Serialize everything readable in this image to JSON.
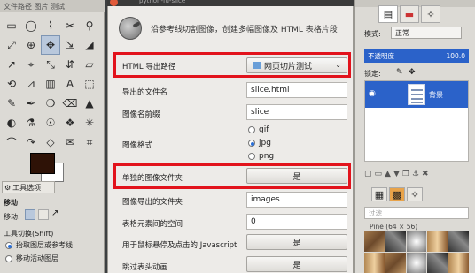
{
  "toolbox": {
    "title": "文件路径 图片 测试",
    "tools": [
      "▭",
      "◯",
      "⌇",
      "✂",
      "⚲",
      "⤢",
      "⊕",
      "✥",
      "⇲",
      "◢",
      "↗",
      "⌖",
      "⤡",
      "⇵",
      "▱",
      "⟲",
      "⊿",
      "▥",
      "A",
      "⬚",
      "✎",
      "✒",
      "❍",
      "⌫",
      "▲",
      "◐",
      "⚗",
      "☉",
      "❖",
      "✳",
      "⌒",
      "↷",
      "◇",
      "✉",
      "⌗"
    ],
    "options_tab": "工具选项",
    "section_move": "移动",
    "move_label": "移动:",
    "toggle_label": "工具切换(Shift)",
    "opt1": "抬取图层或参考线",
    "opt2": "移动活动图层"
  },
  "dialog": {
    "title": "python-fu-slice",
    "header": "沿参考线切割图像，创建多幅图像及 HTML 表格片段",
    "rows": [
      {
        "label": "HTML 导出路径",
        "value": "网页切片测试"
      },
      {
        "label": "导出的文件名",
        "value": "slice.html"
      },
      {
        "label": "图像名前缀",
        "value": "slice"
      },
      {
        "label": "图像格式",
        "opt_gif": "gif",
        "opt_jpg": "jpg",
        "opt_png": "png"
      },
      {
        "label": "单独的图像文件夹",
        "value": "是"
      },
      {
        "label": "图像导出的文件夹",
        "value": "images"
      },
      {
        "label": "表格元素间的空间",
        "value": "0"
      },
      {
        "label": "用于鼠标悬停及点击的 Javascript",
        "value": "是"
      },
      {
        "label": "跳过表头动画",
        "value": "是"
      }
    ]
  },
  "dock": {
    "mode_label": "模式:",
    "mode_value": "正常",
    "opacity_label": "不透明度",
    "opacity_value": "100.0",
    "lock_label": "锁定:",
    "layer_name": "背景",
    "brush_filter": "过滤",
    "brush_name": "Pine (64 × 56)"
  },
  "colors": {
    "highlight_red": "#e2131c",
    "selection_blue": "#2b62c9",
    "foreground_color": "#2e1206"
  }
}
